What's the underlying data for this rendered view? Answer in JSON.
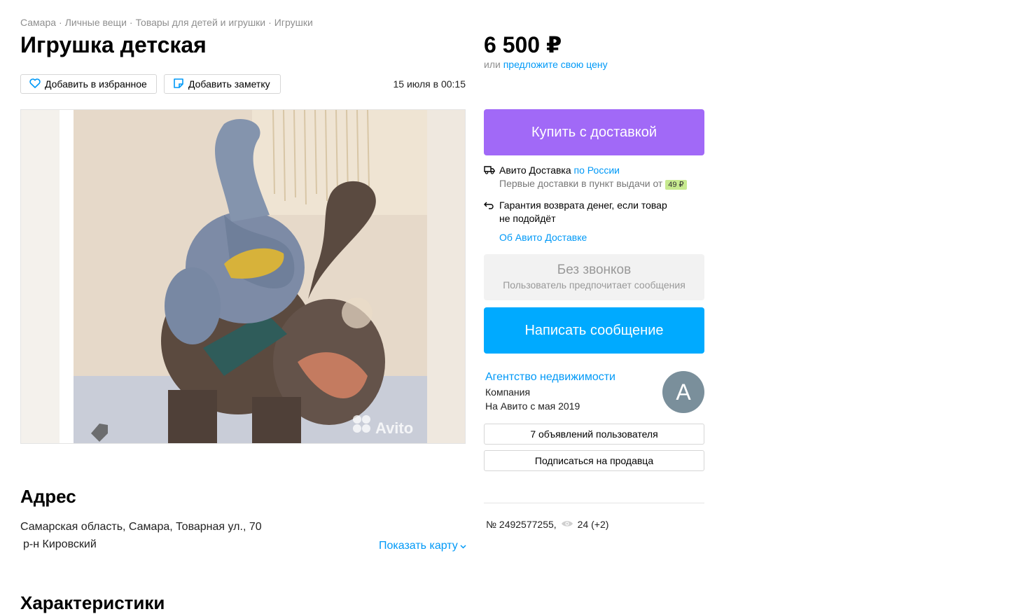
{
  "breadcrumbs": [
    "Самара",
    "Личные вещи",
    "Товары для детей и игрушки",
    "Игрушки"
  ],
  "breadcrumb_separator": "·",
  "title": "Игрушка детская",
  "actions": {
    "favorite_label": "Добавить в избранное",
    "note_label": "Добавить заметку"
  },
  "posted_date": "15 июля в 00:15",
  "price": {
    "value": "6 500 ₽",
    "or_text": "или",
    "offer_link": "предложите свою цену"
  },
  "buy_button": "Купить с доставкой",
  "delivery": {
    "service": "Авито Доставка",
    "region_link": "по России",
    "first_delivery": "Первые доставки в пункт выдачи от",
    "first_delivery_price": "49 ₽",
    "guarantee": "Гарантия возврата денег, если товар не подойдёт",
    "about_link": "Об Авито Доставке"
  },
  "no_calls": {
    "title": "Без звонков",
    "subtitle": "Пользователь предпочитает сообщения"
  },
  "message_button": "Написать сообщение",
  "seller": {
    "name": "Агентство недвижимости",
    "type": "Компания",
    "since": "На Авито с мая 2019",
    "avatar_letter": "А"
  },
  "user_ads_button": "7 объявлений пользователя",
  "subscribe_button": "Подписаться на продавца",
  "listing": {
    "number": "№ 2492577255,",
    "views": "24 (+2)"
  },
  "address": {
    "heading": "Адрес",
    "line": "Самарская область, Самара, Товарная ул., 70",
    "district": "р-н Кировский",
    "map_link": "Показать карту"
  },
  "characteristics_heading": "Характеристики",
  "gallery": {
    "watermark": "Avito"
  },
  "colors": {
    "buy": "#a169f7",
    "message": "#00aaff",
    "link": "#0099f7",
    "badge": "#c7ea8f",
    "avatar": "#7a8f9b"
  }
}
